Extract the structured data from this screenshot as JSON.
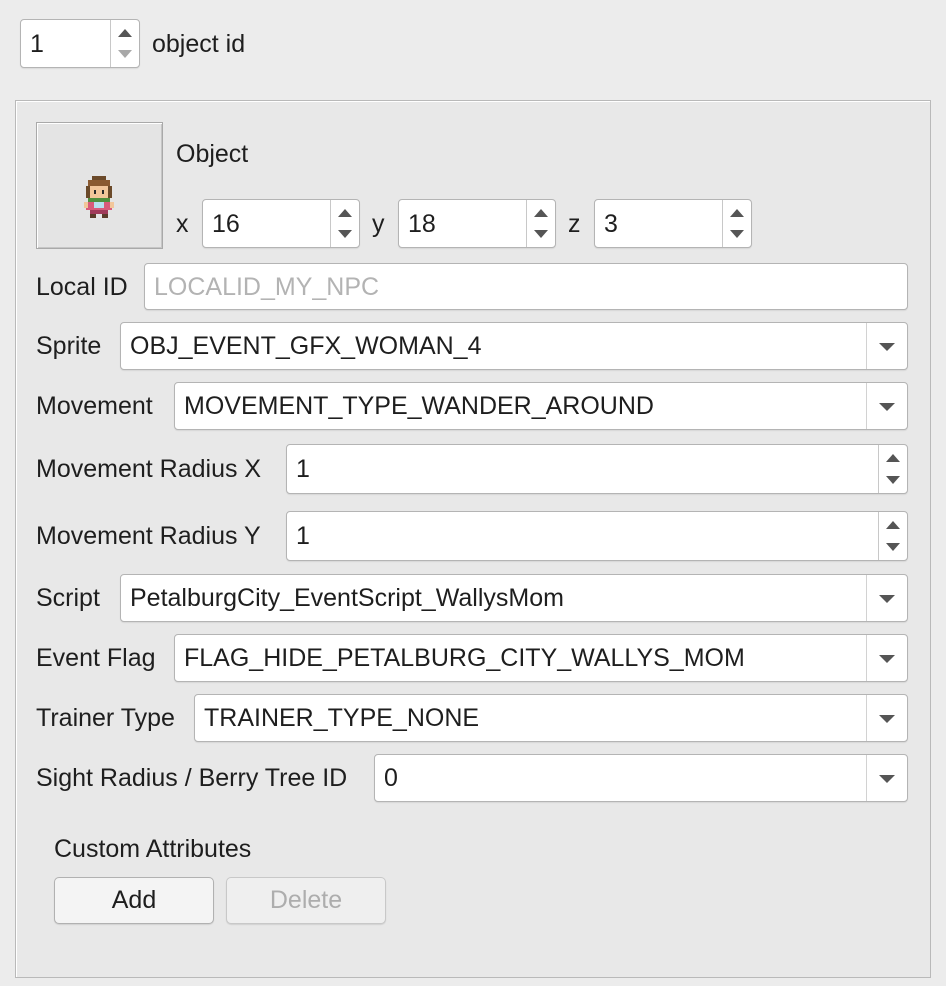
{
  "header": {
    "object_id_value": "1",
    "object_id_label": "object id"
  },
  "object": {
    "heading": "Object",
    "sprite_icon": "npc-woman-sprite-icon",
    "x_label": "x",
    "x_value": "16",
    "y_label": "y",
    "y_value": "18",
    "z_label": "z",
    "z_value": "3"
  },
  "fields": {
    "local_id_label": "Local ID",
    "local_id_placeholder": "LOCALID_MY_NPC",
    "sprite_label": "Sprite",
    "sprite_value": "OBJ_EVENT_GFX_WOMAN_4",
    "movement_label": "Movement",
    "movement_value": "MOVEMENT_TYPE_WANDER_AROUND",
    "radius_x_label": "Movement Radius X",
    "radius_x_value": "1",
    "radius_y_label": "Movement Radius Y",
    "radius_y_value": "1",
    "script_label": "Script",
    "script_value": "PetalburgCity_EventScript_WallysMom",
    "event_flag_label": "Event Flag",
    "event_flag_value": "FLAG_HIDE_PETALBURG_CITY_WALLYS_MOM",
    "trainer_type_label": "Trainer Type",
    "trainer_type_value": "TRAINER_TYPE_NONE",
    "sight_radius_label": "Sight Radius / Berry Tree ID",
    "sight_radius_value": "0"
  },
  "custom_attributes": {
    "heading": "Custom Attributes",
    "add_label": "Add",
    "delete_label": "Delete"
  }
}
